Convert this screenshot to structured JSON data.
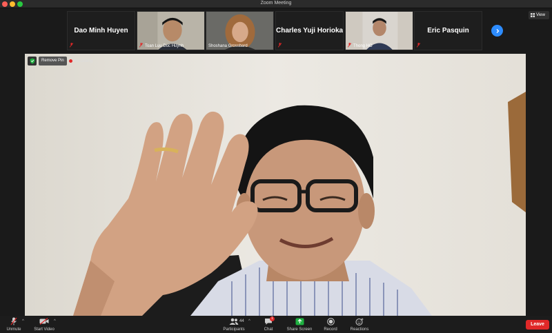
{
  "window": {
    "title": "Zoom Meeting"
  },
  "gallery": {
    "tiles": [
      {
        "name": "Dao Minh Huyen",
        "video": false,
        "mic_muted": true
      },
      {
        "name": "Toan Luu Duc Huynh",
        "video": true,
        "mic_muted": true
      },
      {
        "name": "Shoshana Grossbard",
        "video": true,
        "mic_muted": false
      },
      {
        "name": "Charles Yuji Horioka",
        "video": false,
        "mic_muted": true
      },
      {
        "name": "Thong HO",
        "video": true,
        "mic_muted": true
      },
      {
        "name": "Eric Pasquin",
        "video": false,
        "mic_muted": true
      }
    ],
    "next_icon": "chevron-right-icon"
  },
  "view_button": {
    "label": "View",
    "icon": "grid-icon"
  },
  "main_video": {
    "pin_label": "Remove Pin",
    "recording_label": "Recording",
    "shield_icon": "shield-check-icon"
  },
  "toolbar": {
    "unmute": "Unmute",
    "start_video": "Start Video",
    "participants": "Participants",
    "participants_count": "44",
    "chat": "Chat",
    "chat_badge": "1",
    "share_screen": "Share Screen",
    "record": "Record",
    "reactions": "Reactions",
    "leave": "Leave"
  },
  "colors": {
    "accent_blue": "#2d8cff",
    "share_green": "#1fb141",
    "leave_red": "#e02828",
    "recording_red": "#e02828"
  }
}
